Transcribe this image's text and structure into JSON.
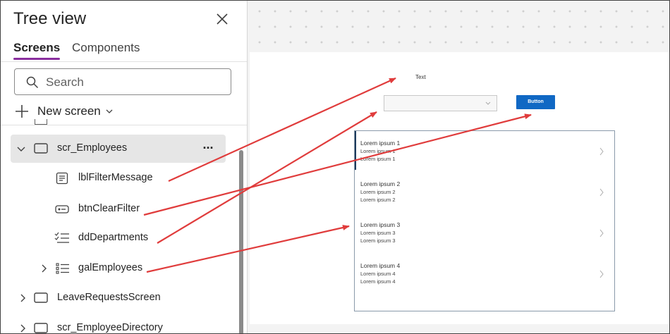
{
  "tree_view": {
    "title": "Tree view",
    "tabs": [
      {
        "label": "Screens",
        "active": true
      },
      {
        "label": "Components",
        "active": false
      }
    ],
    "search": {
      "placeholder": "Search",
      "value": ""
    },
    "new_screen_label": "New screen",
    "items": [
      {
        "label": "scr_Employees",
        "icon": "screen-icon",
        "expanded": true,
        "selected": true
      },
      {
        "label": "lblFilterMessage",
        "icon": "label-icon"
      },
      {
        "label": "btnClearFilter",
        "icon": "button-icon"
      },
      {
        "label": "ddDepartments",
        "icon": "dropdown-icon"
      },
      {
        "label": "galEmployees",
        "icon": "gallery-icon",
        "expanded": false
      },
      {
        "label": "LeaveRequestsScreen",
        "icon": "screen-icon",
        "expanded": false
      },
      {
        "label": "scr_EmployeeDirectory",
        "icon": "screen-icon",
        "expanded": false
      }
    ]
  },
  "canvas": {
    "label_text": "Text",
    "dropdown_value": "",
    "button_label": "Button",
    "gallery": [
      {
        "line1": "Lorem ipsum 1",
        "line2": "Lorem ipsum 1",
        "line3": "Lorem ipsum 1"
      },
      {
        "line1": "Lorem ipsum 2",
        "line2": "Lorem ipsum 2",
        "line3": "Lorem ipsum 2"
      },
      {
        "line1": "Lorem ipsum 3",
        "line2": "Lorem ipsum 3",
        "line3": "Lorem ipsum 3"
      },
      {
        "line1": "Lorem ipsum 4",
        "line2": "Lorem ipsum 4",
        "line3": "Lorem ipsum 4"
      }
    ]
  },
  "colors": {
    "accent": "#8a2e9e",
    "button": "#1068c4",
    "arrow": "#e03c3c"
  }
}
